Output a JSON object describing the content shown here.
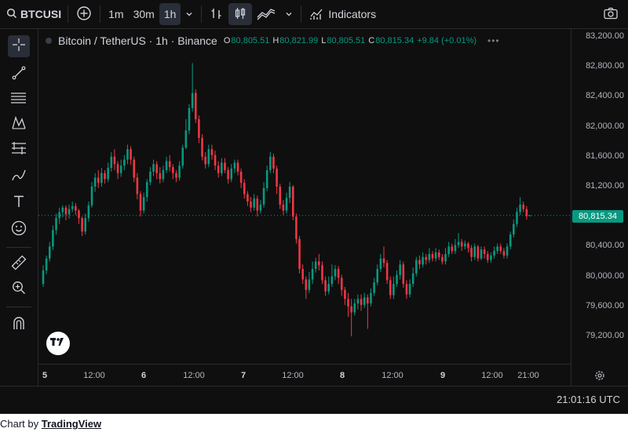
{
  "toolbar": {
    "symbol": "BTCUSI",
    "intervals": [
      "1m",
      "30m",
      "1h"
    ],
    "active_interval": "1h",
    "indicators_label": "Indicators"
  },
  "legend": {
    "title": "Bitcoin / TetherUS · 1h · Binance",
    "o_label": "O",
    "o_value": "80,805.51",
    "h_label": "H",
    "h_value": "80,821.99",
    "l_label": "L",
    "l_value": "80,805.51",
    "c_label": "C",
    "c_value": "80,815.34",
    "change": "+9.84 (+0.01%)"
  },
  "price_tag": "80,815.34",
  "status": {
    "time": "21:01:16 UTC"
  },
  "footer": {
    "prefix": "Chart by",
    "link": "TradingView"
  },
  "colors": {
    "up": "#089981",
    "down": "#f23645",
    "background": "#0f0f0f"
  },
  "icons": [
    "search-icon",
    "add-symbol-icon",
    "interval-dropdown-icon",
    "bar-chart-icon",
    "candles-icon",
    "area-chart-icon",
    "chart-type-dropdown-icon",
    "indicators-icon",
    "camera-icon",
    "crosshair-icon",
    "trendline-icon",
    "fib-icon",
    "pattern-icon",
    "prediction-icon",
    "brush-icon",
    "text-icon",
    "emoji-icon",
    "ruler-icon",
    "zoom-icon",
    "magnet-icon",
    "tv-logo-icon",
    "settings-icon"
  ],
  "chart_data": {
    "type": "candlestick",
    "title": "Bitcoin / TetherUS · 1h · Binance",
    "y_ticks": [
      "83,200.00",
      "82,800.00",
      "82,400.00",
      "82,000.00",
      "81,600.00",
      "81,200.00",
      "80,400.00",
      "80,000.00",
      "79,600.00",
      "79,200.00"
    ],
    "y_tick_values": [
      83200,
      82800,
      82400,
      82000,
      81600,
      81200,
      80400,
      80000,
      79600,
      79200
    ],
    "ylim": [
      79100,
      83250
    ],
    "x_ticks": [
      "5",
      "12:00",
      "6",
      "12:00",
      "7",
      "12:00",
      "8",
      "12:00",
      "9",
      "12:00",
      "21:00"
    ],
    "x_ticks_bold": [
      true,
      false,
      true,
      false,
      true,
      false,
      true,
      false,
      true,
      false,
      false
    ],
    "last_price": 80815.34,
    "candles": [
      [
        79900,
        80080,
        80150,
        79860
      ],
      [
        80080,
        80240,
        80280,
        80030
      ],
      [
        80240,
        80400,
        80460,
        80200
      ],
      [
        80400,
        80620,
        80680,
        80350
      ],
      [
        80620,
        80780,
        80840,
        80560
      ],
      [
        80780,
        80860,
        80920,
        80700
      ],
      [
        80860,
        80920,
        80950,
        80790
      ],
      [
        80920,
        80830,
        80950,
        80750
      ],
      [
        80830,
        80900,
        80960,
        80770
      ],
      [
        80900,
        80940,
        81000,
        80860
      ],
      [
        80940,
        80880,
        80980,
        80820
      ],
      [
        80880,
        80780,
        80900,
        80700
      ],
      [
        80780,
        80600,
        80800,
        80540
      ],
      [
        80600,
        80780,
        80840,
        80560
      ],
      [
        80780,
        80950,
        81000,
        80730
      ],
      [
        80950,
        81200,
        81260,
        80920
      ],
      [
        81200,
        81320,
        81380,
        81130
      ],
      [
        81320,
        81250,
        81420,
        81180
      ],
      [
        81250,
        81380,
        81450,
        81200
      ],
      [
        81380,
        81300,
        81420,
        81240
      ],
      [
        81300,
        81450,
        81520,
        81260
      ],
      [
        81450,
        81600,
        81660,
        81400
      ],
      [
        81600,
        81500,
        81700,
        81420
      ],
      [
        81500,
        81380,
        81540,
        81300
      ],
      [
        81380,
        81480,
        81560,
        81330
      ],
      [
        81480,
        81560,
        81620,
        81420
      ],
      [
        81560,
        81700,
        81760,
        81500
      ],
      [
        81700,
        81560,
        81740,
        81490
      ],
      [
        81560,
        81320,
        81600,
        81260
      ],
      [
        81320,
        81100,
        81380,
        81030
      ],
      [
        81100,
        80880,
        81140,
        80800
      ],
      [
        80880,
        81060,
        81120,
        80840
      ],
      [
        81060,
        81260,
        81300,
        81000
      ],
      [
        81260,
        81400,
        81460,
        81220
      ],
      [
        81400,
        81500,
        81560,
        81340
      ],
      [
        81500,
        81380,
        81540,
        81300
      ],
      [
        81380,
        81300,
        81460,
        81240
      ],
      [
        81300,
        81420,
        81480,
        81260
      ],
      [
        81420,
        81540,
        81600,
        81380
      ],
      [
        81540,
        81460,
        81620,
        81400
      ],
      [
        81460,
        81380,
        81500,
        81300
      ],
      [
        81380,
        81320,
        81420,
        81260
      ],
      [
        81320,
        81480,
        81540,
        81280
      ],
      [
        81480,
        81720,
        81760,
        81440
      ],
      [
        81720,
        81950,
        82100,
        81700
      ],
      [
        81950,
        82250,
        82300,
        81900
      ],
      [
        82250,
        82450,
        82850,
        82200
      ],
      [
        82450,
        82100,
        82500,
        82050
      ],
      [
        82100,
        81850,
        82150,
        81780
      ],
      [
        81850,
        81600,
        81900,
        81550
      ],
      [
        81600,
        81500,
        81660,
        81440
      ],
      [
        81500,
        81700,
        81760,
        81460
      ],
      [
        81700,
        81620,
        81760,
        81560
      ],
      [
        81620,
        81480,
        81680,
        81420
      ],
      [
        81480,
        81380,
        81540,
        81320
      ],
      [
        81380,
        81520,
        81580,
        81340
      ],
      [
        81520,
        81420,
        81580,
        81380
      ],
      [
        81420,
        81300,
        81460,
        81240
      ],
      [
        81300,
        81440,
        81500,
        81260
      ],
      [
        81440,
        81520,
        81560,
        81380
      ],
      [
        81520,
        81400,
        81560,
        81350
      ],
      [
        81400,
        81250,
        81440,
        81180
      ],
      [
        81250,
        81100,
        81300,
        81040
      ],
      [
        81100,
        81000,
        81140,
        80940
      ],
      [
        81000,
        80920,
        81060,
        80860
      ],
      [
        80920,
        81040,
        81100,
        80880
      ],
      [
        81040,
        80880,
        81080,
        80800
      ],
      [
        80880,
        80960,
        81020,
        80840
      ],
      [
        80960,
        81180,
        81260,
        80920
      ],
      [
        81180,
        81420,
        81480,
        81140
      ],
      [
        81420,
        81600,
        81660,
        81380
      ],
      [
        81600,
        81440,
        81640,
        81380
      ],
      [
        81440,
        81200,
        81480,
        81100
      ],
      [
        81200,
        80960,
        81240,
        80900
      ],
      [
        80960,
        80880,
        81020,
        80820
      ],
      [
        80880,
        81050,
        81120,
        80840
      ],
      [
        81050,
        81200,
        81260,
        80980
      ],
      [
        81200,
        80800,
        81220,
        80750
      ],
      [
        80800,
        80500,
        80840,
        80440
      ],
      [
        80500,
        80100,
        80540,
        80040
      ],
      [
        80100,
        79960,
        80160,
        79900
      ],
      [
        79960,
        79820,
        80000,
        79700
      ],
      [
        79820,
        79960,
        80060,
        79780
      ],
      [
        79960,
        80100,
        80200,
        79900
      ],
      [
        80100,
        80200,
        80250,
        80050
      ],
      [
        80200,
        80150,
        80300,
        80080
      ],
      [
        80150,
        79950,
        80200,
        79900
      ],
      [
        79950,
        79800,
        80000,
        79740
      ],
      [
        79800,
        79900,
        80000,
        79760
      ],
      [
        79900,
        80000,
        80160,
        79860
      ],
      [
        80000,
        80100,
        80150,
        79950
      ],
      [
        80100,
        79980,
        80140,
        79900
      ],
      [
        79980,
        79820,
        80020,
        79740
      ],
      [
        79820,
        79700,
        79860,
        79620
      ],
      [
        79700,
        79600,
        79780,
        79460
      ],
      [
        79600,
        79520,
        79700,
        79200
      ],
      [
        79520,
        79640,
        79700,
        79480
      ],
      [
        79640,
        79700,
        79760,
        79560
      ],
      [
        79700,
        79620,
        79760,
        79540
      ],
      [
        79620,
        79720,
        79780,
        79580
      ],
      [
        79720,
        79640,
        79760,
        79300
      ],
      [
        79640,
        79780,
        79840,
        79600
      ],
      [
        79780,
        79920,
        79980,
        79740
      ],
      [
        79920,
        80100,
        80160,
        79880
      ],
      [
        80100,
        80240,
        80300,
        80060
      ],
      [
        80240,
        80180,
        80400,
        80120
      ],
      [
        80180,
        79950,
        80220,
        79900
      ],
      [
        79950,
        79750,
        80000,
        79700
      ],
      [
        79750,
        79900,
        80000,
        79700
      ],
      [
        79900,
        80020,
        80080,
        79860
      ],
      [
        80020,
        80160,
        80220,
        79960
      ],
      [
        80160,
        79900,
        80200,
        79850
      ],
      [
        79900,
        79760,
        79950,
        79700
      ],
      [
        79760,
        79900,
        79960,
        79720
      ],
      [
        79900,
        80040,
        80120,
        79860
      ],
      [
        80040,
        80220,
        80260,
        80000
      ],
      [
        80220,
        80160,
        80280,
        80100
      ],
      [
        80160,
        80260,
        80320,
        80120
      ],
      [
        80260,
        80220,
        80300,
        80160
      ],
      [
        80220,
        80300,
        80380,
        80180
      ],
      [
        80300,
        80240,
        80340,
        80200
      ],
      [
        80240,
        80320,
        80380,
        80200
      ],
      [
        80320,
        80260,
        80360,
        80220
      ],
      [
        80260,
        80200,
        80300,
        80160
      ],
      [
        80200,
        80300,
        80380,
        80160
      ],
      [
        80300,
        80400,
        80460,
        80260
      ],
      [
        80400,
        80340,
        80440,
        80300
      ],
      [
        80340,
        80420,
        80500,
        80300
      ],
      [
        80420,
        80460,
        80580,
        80380
      ],
      [
        80460,
        80400,
        80500,
        80340
      ],
      [
        80400,
        80440,
        80480,
        80360
      ],
      [
        80440,
        80380,
        80460,
        80320
      ],
      [
        80380,
        80260,
        80420,
        80200
      ],
      [
        80260,
        80400,
        80440,
        80220
      ],
      [
        80400,
        80240,
        80420,
        80200
      ],
      [
        80240,
        80360,
        80400,
        80220
      ],
      [
        80360,
        80300,
        80400,
        80240
      ],
      [
        80300,
        80220,
        80340,
        80180
      ],
      [
        80220,
        80280,
        80320,
        80180
      ],
      [
        80280,
        80340,
        80400,
        80240
      ],
      [
        80340,
        80400,
        80440,
        80300
      ],
      [
        80400,
        80340,
        80440,
        80300
      ],
      [
        80340,
        80280,
        80380,
        80240
      ],
      [
        80280,
        80400,
        80440,
        80240
      ],
      [
        80400,
        80560,
        80600,
        80360
      ],
      [
        80560,
        80700,
        80760,
        80520
      ],
      [
        80700,
        80860,
        80920,
        80660
      ],
      [
        80860,
        80960,
        81060,
        80820
      ],
      [
        80960,
        80900,
        81000,
        80860
      ],
      [
        80900,
        80805.51,
        80940,
        80760
      ],
      [
        80805.51,
        80815.34,
        80821.99,
        80805.51
      ]
    ]
  }
}
